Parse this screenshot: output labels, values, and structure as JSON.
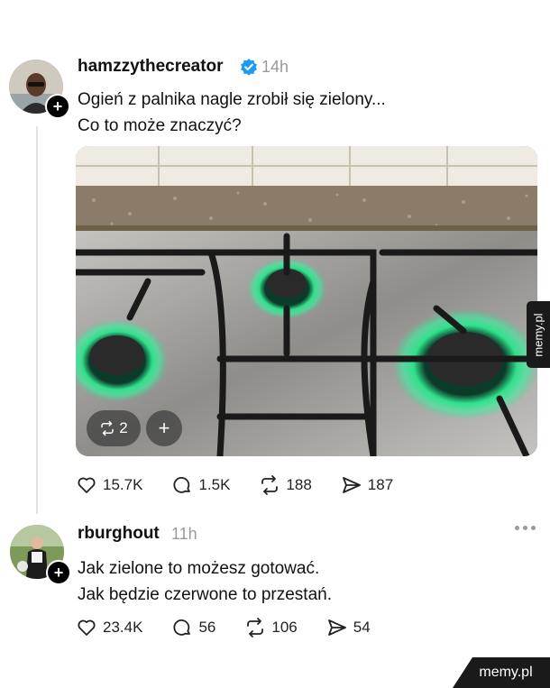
{
  "post": {
    "username": "hamzzythecreator",
    "verified": true,
    "time": "14h",
    "text_line1": "Ogień z palnika nagle zrobił się zielony...",
    "text_line2": "Co to może znaczyć?",
    "media": {
      "description_icon": "stove-photo",
      "repost_chip_count": "2",
      "add_chip_label": "+"
    },
    "stats": {
      "likes": "15.7K",
      "comments": "1.5K",
      "reposts": "188",
      "shares": "187"
    }
  },
  "reply": {
    "username": "rburghout",
    "time": "11h",
    "text_line1": "Jak zielone to możesz gotować.",
    "text_line2": "Jak będzie czerwone to przestań.",
    "stats": {
      "likes": "23.4K",
      "comments": "56",
      "reposts": "106",
      "shares": "54"
    }
  },
  "watermarks": {
    "side": "memy.pl",
    "corner": "memy.pl"
  },
  "colors": {
    "verified_badge": "#1d9bf0",
    "flame": "#2fe08a",
    "muted_text": "#9a9a9a"
  }
}
